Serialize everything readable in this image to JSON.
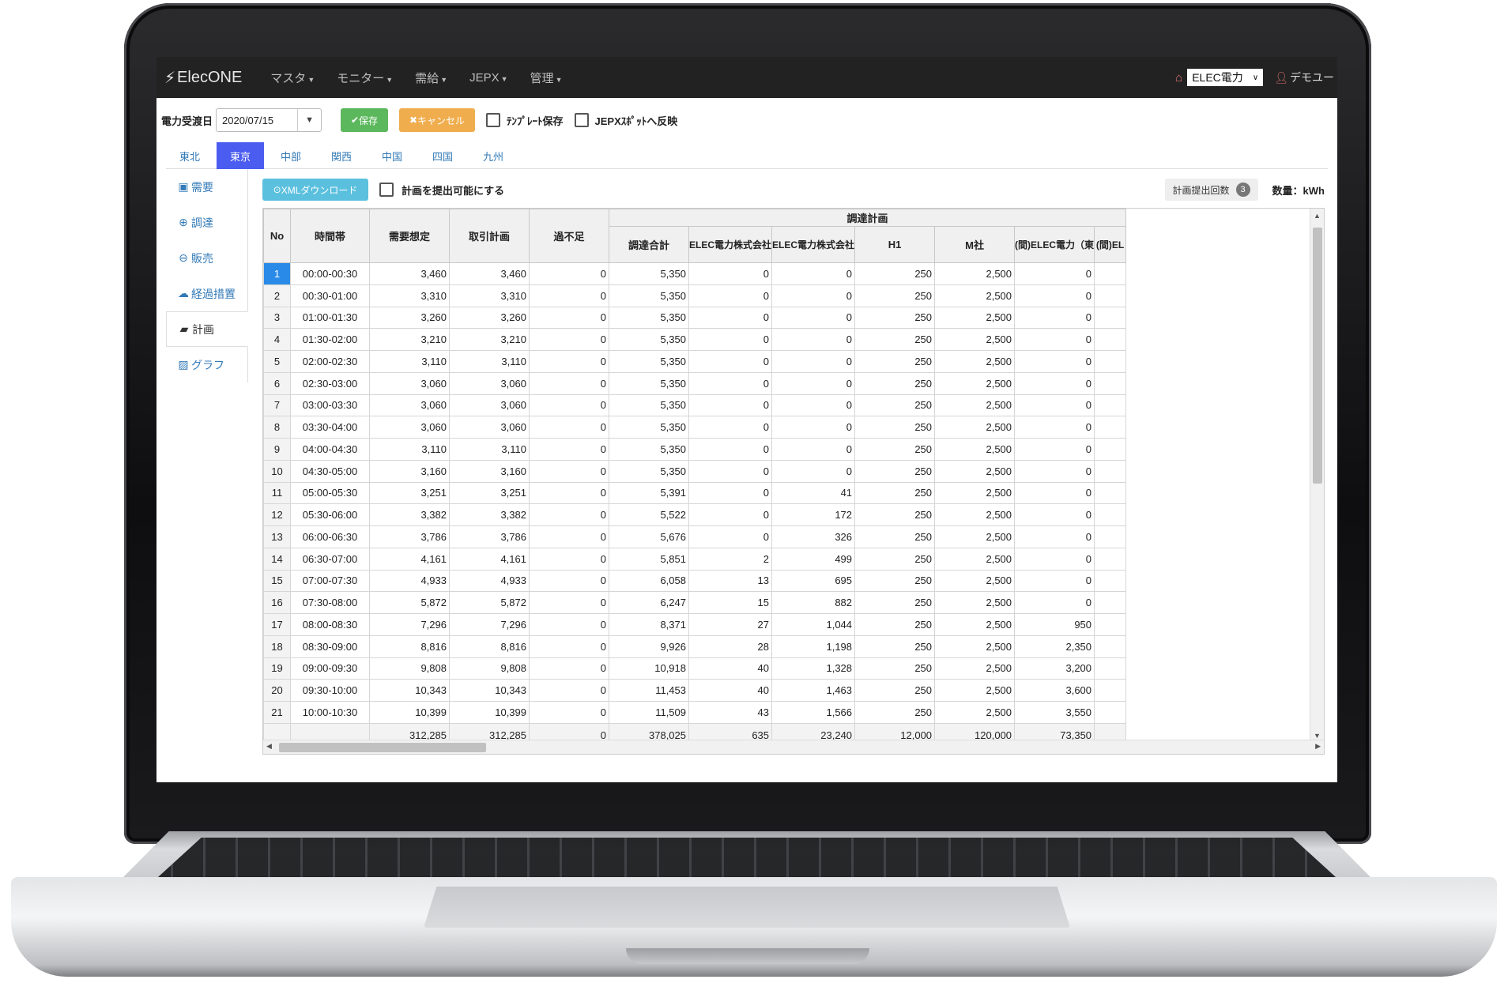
{
  "navbar": {
    "brand": "ElecONE",
    "menus": [
      "マスタ",
      "モニター",
      "需給",
      "JEPX",
      "管理"
    ],
    "company": "ELEC電力",
    "user": "デモユー"
  },
  "toolbar": {
    "date_label": "電力受渡日",
    "date_value": "2020/07/15",
    "save_label": "保存",
    "cancel_label": "キャンセル",
    "template_save_label": "ﾃﾝﾌﾟﾚｰﾄ保存",
    "jepx_label": "JEPXｽﾎﾟｯﾄへ反映"
  },
  "area_tabs": [
    "東北",
    "東京",
    "中部",
    "関西",
    "中国",
    "四国",
    "九州"
  ],
  "area_tabs_active": "東京",
  "sidebar": [
    "需要",
    "調達",
    "販売",
    "経過措置",
    "計画",
    "グラフ"
  ],
  "sidebar_active": "計画",
  "subbar": {
    "xml_download_label": "XMLダウンロード",
    "submit_enable_label": "計画を提出可能にする",
    "submit_count_label": "計画提出回数",
    "submit_count": "3",
    "unit_label": "数量：kWh"
  },
  "grid": {
    "group_header": "調達計画",
    "columns": [
      "No",
      "時間帯",
      "需要想定",
      "取引計画",
      "過不足",
      "調達合計",
      "ELEC電力株式会社",
      "ELEC電力株式会社",
      "H1",
      "M社",
      "(間)ELEC電力（東",
      "(間)EL"
    ],
    "rows": [
      [
        "1",
        "00:00-00:30",
        "3,460",
        "3,460",
        "0",
        "5,350",
        "0",
        "0",
        "250",
        "2,500",
        "0",
        ""
      ],
      [
        "2",
        "00:30-01:00",
        "3,310",
        "3,310",
        "0",
        "5,350",
        "0",
        "0",
        "250",
        "2,500",
        "0",
        ""
      ],
      [
        "3",
        "01:00-01:30",
        "3,260",
        "3,260",
        "0",
        "5,350",
        "0",
        "0",
        "250",
        "2,500",
        "0",
        ""
      ],
      [
        "4",
        "01:30-02:00",
        "3,210",
        "3,210",
        "0",
        "5,350",
        "0",
        "0",
        "250",
        "2,500",
        "0",
        ""
      ],
      [
        "5",
        "02:00-02:30",
        "3,110",
        "3,110",
        "0",
        "5,350",
        "0",
        "0",
        "250",
        "2,500",
        "0",
        ""
      ],
      [
        "6",
        "02:30-03:00",
        "3,060",
        "3,060",
        "0",
        "5,350",
        "0",
        "0",
        "250",
        "2,500",
        "0",
        ""
      ],
      [
        "7",
        "03:00-03:30",
        "3,060",
        "3,060",
        "0",
        "5,350",
        "0",
        "0",
        "250",
        "2,500",
        "0",
        ""
      ],
      [
        "8",
        "03:30-04:00",
        "3,060",
        "3,060",
        "0",
        "5,350",
        "0",
        "0",
        "250",
        "2,500",
        "0",
        ""
      ],
      [
        "9",
        "04:00-04:30",
        "3,110",
        "3,110",
        "0",
        "5,350",
        "0",
        "0",
        "250",
        "2,500",
        "0",
        ""
      ],
      [
        "10",
        "04:30-05:00",
        "3,160",
        "3,160",
        "0",
        "5,350",
        "0",
        "0",
        "250",
        "2,500",
        "0",
        ""
      ],
      [
        "11",
        "05:00-05:30",
        "3,251",
        "3,251",
        "0",
        "5,391",
        "0",
        "41",
        "250",
        "2,500",
        "0",
        ""
      ],
      [
        "12",
        "05:30-06:00",
        "3,382",
        "3,382",
        "0",
        "5,522",
        "0",
        "172",
        "250",
        "2,500",
        "0",
        ""
      ],
      [
        "13",
        "06:00-06:30",
        "3,786",
        "3,786",
        "0",
        "5,676",
        "0",
        "326",
        "250",
        "2,500",
        "0",
        ""
      ],
      [
        "14",
        "06:30-07:00",
        "4,161",
        "4,161",
        "0",
        "5,851",
        "2",
        "499",
        "250",
        "2,500",
        "0",
        ""
      ],
      [
        "15",
        "07:00-07:30",
        "4,933",
        "4,933",
        "0",
        "6,058",
        "13",
        "695",
        "250",
        "2,500",
        "0",
        ""
      ],
      [
        "16",
        "07:30-08:00",
        "5,872",
        "5,872",
        "0",
        "6,247",
        "15",
        "882",
        "250",
        "2,500",
        "0",
        ""
      ],
      [
        "17",
        "08:00-08:30",
        "7,296",
        "7,296",
        "0",
        "8,371",
        "27",
        "1,044",
        "250",
        "2,500",
        "950",
        ""
      ],
      [
        "18",
        "08:30-09:00",
        "8,816",
        "8,816",
        "0",
        "9,926",
        "28",
        "1,198",
        "250",
        "2,500",
        "2,350",
        ""
      ],
      [
        "19",
        "09:00-09:30",
        "9,808",
        "9,808",
        "0",
        "10,918",
        "40",
        "1,328",
        "250",
        "2,500",
        "3,200",
        ""
      ],
      [
        "20",
        "09:30-10:00",
        "10,343",
        "10,343",
        "0",
        "11,453",
        "40",
        "1,463",
        "250",
        "2,500",
        "3,600",
        ""
      ],
      [
        "21",
        "10:00-10:30",
        "10,399",
        "10,399",
        "0",
        "11,509",
        "43",
        "1,566",
        "250",
        "2,500",
        "3,550",
        ""
      ]
    ],
    "totals": [
      "",
      "",
      "312,285",
      "312,285",
      "0",
      "378,025",
      "635",
      "23,240",
      "12,000",
      "120,000",
      "73,350",
      ""
    ],
    "selected_row": "1"
  },
  "icons": {
    "brand": "bolt-icon",
    "home": "home-icon",
    "user": "user-icon",
    "save": "check-icon",
    "cancel": "x-icon",
    "xml": "download-icon",
    "sidebar": [
      "save-disk-icon",
      "plus-circle-icon",
      "minus-circle-icon",
      "cloud-upload-icon",
      "folder-open-icon",
      "picture-icon"
    ]
  },
  "colors": {
    "navbar": "#222222",
    "tab_active": "#4b5cf0",
    "link": "#337ab7",
    "save_button": "#5cb85c",
    "cancel_button": "#f0ad4e",
    "xml_button": "#5bc0de",
    "selected_cell": "#2a8ae8"
  }
}
